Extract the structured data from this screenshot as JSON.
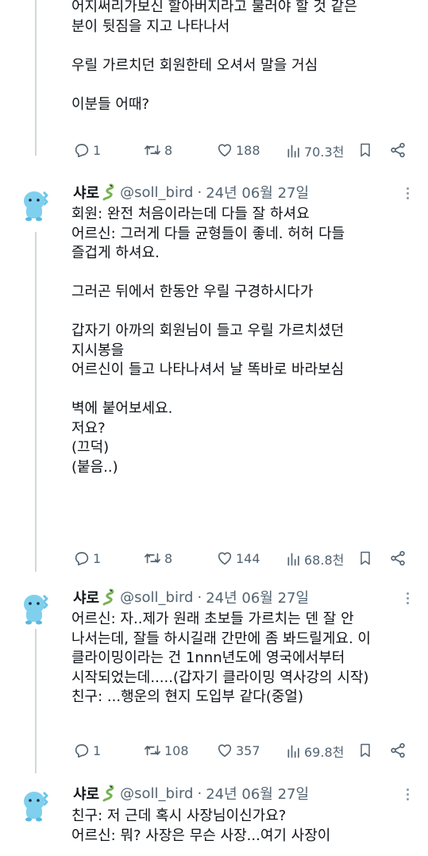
{
  "tweets": [
    {
      "lines": [
        "어지써리가보신 할아버지라고 불러야 할 것 같은",
        "분이 뒷짐을 지고 나타나서",
        "",
        "우릴 가르치던 회원한테 오셔서 말을 거심",
        "",
        "이분들 어때?"
      ],
      "replies": "1",
      "retweets": "8",
      "likes": "188",
      "views": "70.3천"
    },
    {
      "name": "샤로",
      "handle": "@soll_bird",
      "date": "24년 06월 27일",
      "lines": [
        "회원: 완전 처음이라는데 다들 잘 하셔요",
        "어르신: 그러게 다들 균형들이 좋네. 허허 다들",
        "즐겁게 하셔요.",
        "",
        "그러곤 뒤에서 한동안 우릴 구경하시다가",
        "",
        "갑자기 아까의 회원님이 들고 우릴 가르치셨던",
        "지시봉을",
        "어르신이 들고 나타나셔서 날 똑바로 바라보심",
        "",
        "벽에 붙어보세요.",
        "저요?",
        "(끄덕)",
        "(붙음..)"
      ],
      "replies": "1",
      "retweets": "8",
      "likes": "144",
      "views": "68.8천"
    },
    {
      "name": "샤로",
      "handle": "@soll_bird",
      "date": "24년 06월 27일",
      "lines": [
        "어르신: 자..제가 원래 초보들 가르치는 덴 잘 안",
        "나서는데, 잘들 하시길래 간만에 좀 봐드릴게요. 이",
        "클라이밍이라는 건 1nnn년도에 영국에서부터",
        "시작되었는데.....(갑자기 클라이밍 역사강의 시작)",
        "친구: ...행운의 현지 도입부 같다(중얼)"
      ],
      "replies": "1",
      "retweets": "108",
      "likes": "357",
      "views": "69.8천"
    },
    {
      "name": "샤로",
      "handle": "@soll_bird",
      "date": "24년 06월 27일",
      "lines": [
        "친구: 저 근데 혹시 사장님이신가요?",
        "어르신: 뭐? 사장은 무슨 사장...여기 사장이"
      ]
    }
  ],
  "colors": {
    "accent": "#1d9bf0",
    "muted": "#536471",
    "text": "#0f1419",
    "thread_line": "#cfd9de"
  },
  "icons": [
    "reply-icon",
    "retweet-icon",
    "like-icon",
    "views-icon",
    "bookmark-icon",
    "share-icon",
    "more-icon",
    "snake-emoji-icon"
  ]
}
